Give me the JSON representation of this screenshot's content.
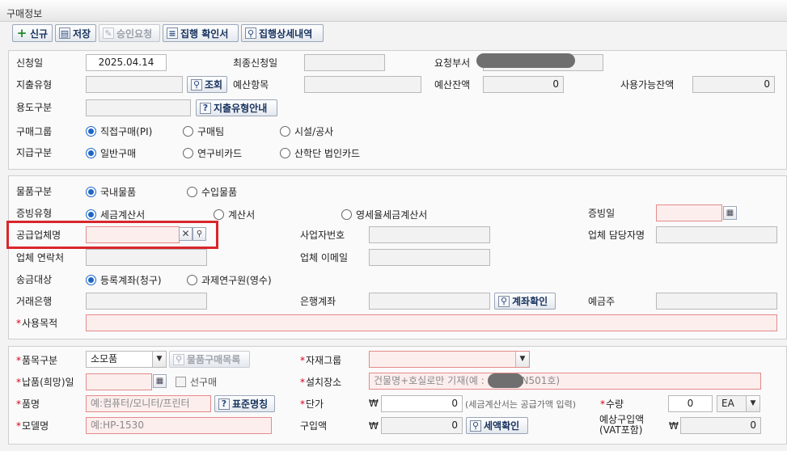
{
  "window": {
    "title": "구매정보"
  },
  "toolbar": {
    "new_label": "신규",
    "save_label": "저장",
    "approve_label": "승인요청",
    "execution_confirm_label": "집행 확인서",
    "execution_detail_label": "집행상세내역"
  },
  "section1": {
    "apply_date_label": "신청일",
    "apply_date_value": "2025.04.14",
    "final_apply_date_label": "최종신청일",
    "final_apply_date_value": "",
    "request_dept_label": "요청부서",
    "expense_type_label": "지출유형",
    "expense_type_value": "",
    "search_button_label": "조회",
    "budget_item_label": "예산항목",
    "budget_item_value": "",
    "budget_balance_label": "예산잔액",
    "budget_balance_value": "0",
    "available_balance_label": "사용가능잔액",
    "available_balance_value": "0",
    "usage_type_label": "용도구분",
    "usage_type_value": "",
    "expense_guide_button_label": "지출유형안내",
    "purchase_group_label": "구매그룹",
    "purchase_group_options": [
      "직접구매(PI)",
      "구매팀",
      "시설/공사"
    ],
    "purchase_group_selected": "직접구매(PI)",
    "payment_type_label": "지급구분",
    "payment_type_options": [
      "일반구매",
      "연구비카드",
      "산학단 법인카드"
    ],
    "payment_type_selected": "일반구매"
  },
  "section2": {
    "goods_type_label": "물품구분",
    "goods_type_options": [
      "국내물품",
      "수입물품"
    ],
    "goods_type_selected": "국내물품",
    "evidence_type_label": "증빙유형",
    "evidence_type_options": [
      "세금계산서",
      "계산서",
      "영세율세금계산서"
    ],
    "evidence_type_selected": "세금계산서",
    "evidence_date_label": "증빙일",
    "evidence_date_value": "",
    "supplier_name_label": "공급업체명",
    "supplier_name_value": "",
    "business_no_label": "사업자번호",
    "business_no_value": "",
    "supplier_contact_name_label": "업체 담당자명",
    "supplier_contact_name_value": "",
    "supplier_phone_label": "업체 연락처",
    "supplier_phone_value": "",
    "supplier_email_label": "업체 이메일",
    "supplier_email_value": "",
    "remit_target_label": "송금대상",
    "remit_target_options": [
      "등록계좌(청구)",
      "과제연구원(영수)"
    ],
    "remit_target_selected": "등록계좌(청구)",
    "bank_label": "거래은행",
    "bank_value": "",
    "bank_account_label": "은행계좌",
    "bank_account_value": "",
    "account_check_button_label": "계좌확인",
    "account_holder_label": "예금주",
    "account_holder_value": "",
    "purpose_label": "사용목적",
    "purpose_value": ""
  },
  "section3": {
    "item_type_label": "품목구분",
    "item_type_value": "소모품",
    "item_catalog_button_label": "물품구매목록",
    "material_group_label": "자재그룹",
    "material_group_value": "",
    "delivery_date_label": "납품(희망)일",
    "delivery_date_value": "",
    "pre_purchase_label": "선구매",
    "install_location_label": "설치장소",
    "install_location_placeholder_prefix": "건물명+호실로만 기재(예 :",
    "install_location_placeholder_suffix": "N501호)",
    "item_name_label": "품명",
    "item_name_placeholder": "예:컴퓨터/모니터/프린터",
    "standard_name_button_label": "표준명칭",
    "unit_price_label": "단가",
    "currency_symbol": "₩",
    "unit_price_value": "0",
    "tax_note": "(세금계산서는 공급가액 입력)",
    "quantity_label": "수량",
    "quantity_value": "0",
    "unit_value": "EA",
    "model_name_label": "모델명",
    "model_name_placeholder": "예:HP-1530",
    "purchase_amount_label": "구입액",
    "purchase_amount_value": "0",
    "amount_check_button_label": "세액확인",
    "expected_amount_label_line1": "예상구입액",
    "expected_amount_label_line2": "(VAT포함)",
    "expected_amount_value": "0"
  }
}
